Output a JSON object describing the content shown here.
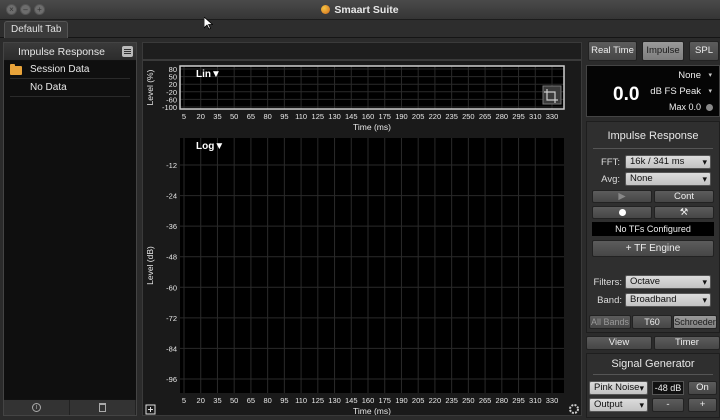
{
  "window": {
    "title": "Smaart Suite"
  },
  "tabs": [
    {
      "label": "Default Tab"
    }
  ],
  "left_panel": {
    "title": "Impulse Response",
    "tree": [
      {
        "label": "Session Data"
      },
      {
        "label": "No Data"
      }
    ]
  },
  "top_plot": {
    "title": "Lin▼",
    "ylabel": "Level (%)",
    "xlabel": "Time (ms)",
    "yticks": [
      "80",
      "50",
      "20",
      "-20",
      "-60",
      "-100"
    ],
    "xticks": [
      "5",
      "20",
      "35",
      "50",
      "65",
      "80",
      "95",
      "110",
      "125",
      "130",
      "145",
      "160",
      "175",
      "190",
      "205",
      "220",
      "235",
      "250",
      "265",
      "280",
      "295",
      "310",
      "330"
    ]
  },
  "bottom_plot": {
    "title": "Log▼",
    "ylabel": "Level (dB)",
    "xlabel": "Time (ms)",
    "yticks": [
      "-12",
      "-24",
      "-36",
      "-48",
      "-60",
      "-72",
      "-84",
      "-96"
    ],
    "xticks": [
      "5",
      "20",
      "35",
      "50",
      "65",
      "80",
      "95",
      "110",
      "125",
      "130",
      "145",
      "160",
      "175",
      "190",
      "205",
      "220",
      "235",
      "250",
      "265",
      "280",
      "295",
      "310",
      "330"
    ]
  },
  "mode_buttons": [
    "Real Time",
    "Impulse",
    "SPL"
  ],
  "meter": {
    "value": "0.0",
    "source": "None",
    "mode": "dB FS Peak",
    "max": "Max 0.0"
  },
  "impulse_panel": {
    "title": "Impulse Response",
    "fft_label": "FFT:",
    "fft_value": "16k / 341 ms",
    "avg_label": "Avg:",
    "avg_value": "None",
    "cont_label": "Cont",
    "tfs_status": "No TFs Configured",
    "tf_engine_label": "+ TF Engine",
    "filters_label": "Filters:",
    "filters_value": "Octave",
    "band_label": "Band:",
    "band_value": "Broadband",
    "tabs": [
      "All Bands",
      "T60",
      "Schroeder"
    ]
  },
  "view_timer": [
    "View",
    "Timer"
  ],
  "signal_generator": {
    "title": "Signal Generator",
    "signal_value": "Pink Noise",
    "level": "-48 dB",
    "on_label": "On",
    "output_value": "Output",
    "minus_label": "-",
    "plus_label": "+"
  },
  "colors": {
    "plot_bg": "#000000",
    "grid": "#2a2a2a",
    "accent_button": "#8e8e8e"
  }
}
